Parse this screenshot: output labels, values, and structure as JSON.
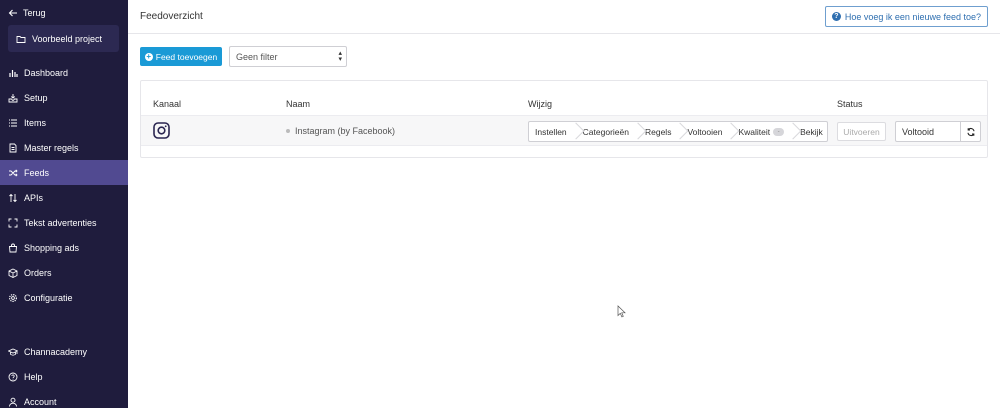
{
  "sidebar": {
    "back_label": "Terug",
    "project_label": "Voorbeeld project",
    "items": [
      {
        "label": "Dashboard",
        "icon": "bar-chart-icon"
      },
      {
        "label": "Setup",
        "icon": "inbox-icon"
      },
      {
        "label": "Items",
        "icon": "list-icon"
      },
      {
        "label": "Master regels",
        "icon": "document-icon"
      },
      {
        "label": "Feeds",
        "icon": "shuffle-icon",
        "active": true
      },
      {
        "label": "APIs",
        "icon": "arrows-updown-icon"
      },
      {
        "label": "Tekst advertenties",
        "icon": "expand-icon"
      },
      {
        "label": "Shopping ads",
        "icon": "shopping-bag-icon"
      },
      {
        "label": "Orders",
        "icon": "box-icon"
      },
      {
        "label": "Configuratie",
        "icon": "gear-icon"
      }
    ],
    "bottom_items": [
      {
        "label": "Channacademy",
        "icon": "graduation-cap-icon"
      },
      {
        "label": "Help",
        "icon": "question-icon"
      },
      {
        "label": "Account",
        "icon": "user-icon"
      }
    ]
  },
  "header": {
    "title": "Feedoverzicht",
    "help_label": "Hoe voeg ik een nieuwe feed toe?"
  },
  "toolbar": {
    "add_label": "Feed toevoegen",
    "filter_value": "Geen filter"
  },
  "table": {
    "columns": {
      "channel": "Kanaal",
      "name": "Naam",
      "edit": "Wijzig",
      "status": "Status"
    },
    "rows": [
      {
        "channel_icon": "instagram-icon",
        "name": "Instagram (by Facebook)",
        "steps": [
          "Instellen",
          "Categorieën",
          "Regels",
          "Voltooien",
          "Kwaliteit",
          "Bekijk"
        ],
        "quality_badge": "-",
        "run_label": "Uitvoeren",
        "status": "Voltooid"
      }
    ]
  },
  "colors": {
    "sidebar_bg": "#1f1c3d",
    "sidebar_active": "#514a91",
    "primary": "#1a9ad6",
    "help_border": "#6f9fcf"
  }
}
